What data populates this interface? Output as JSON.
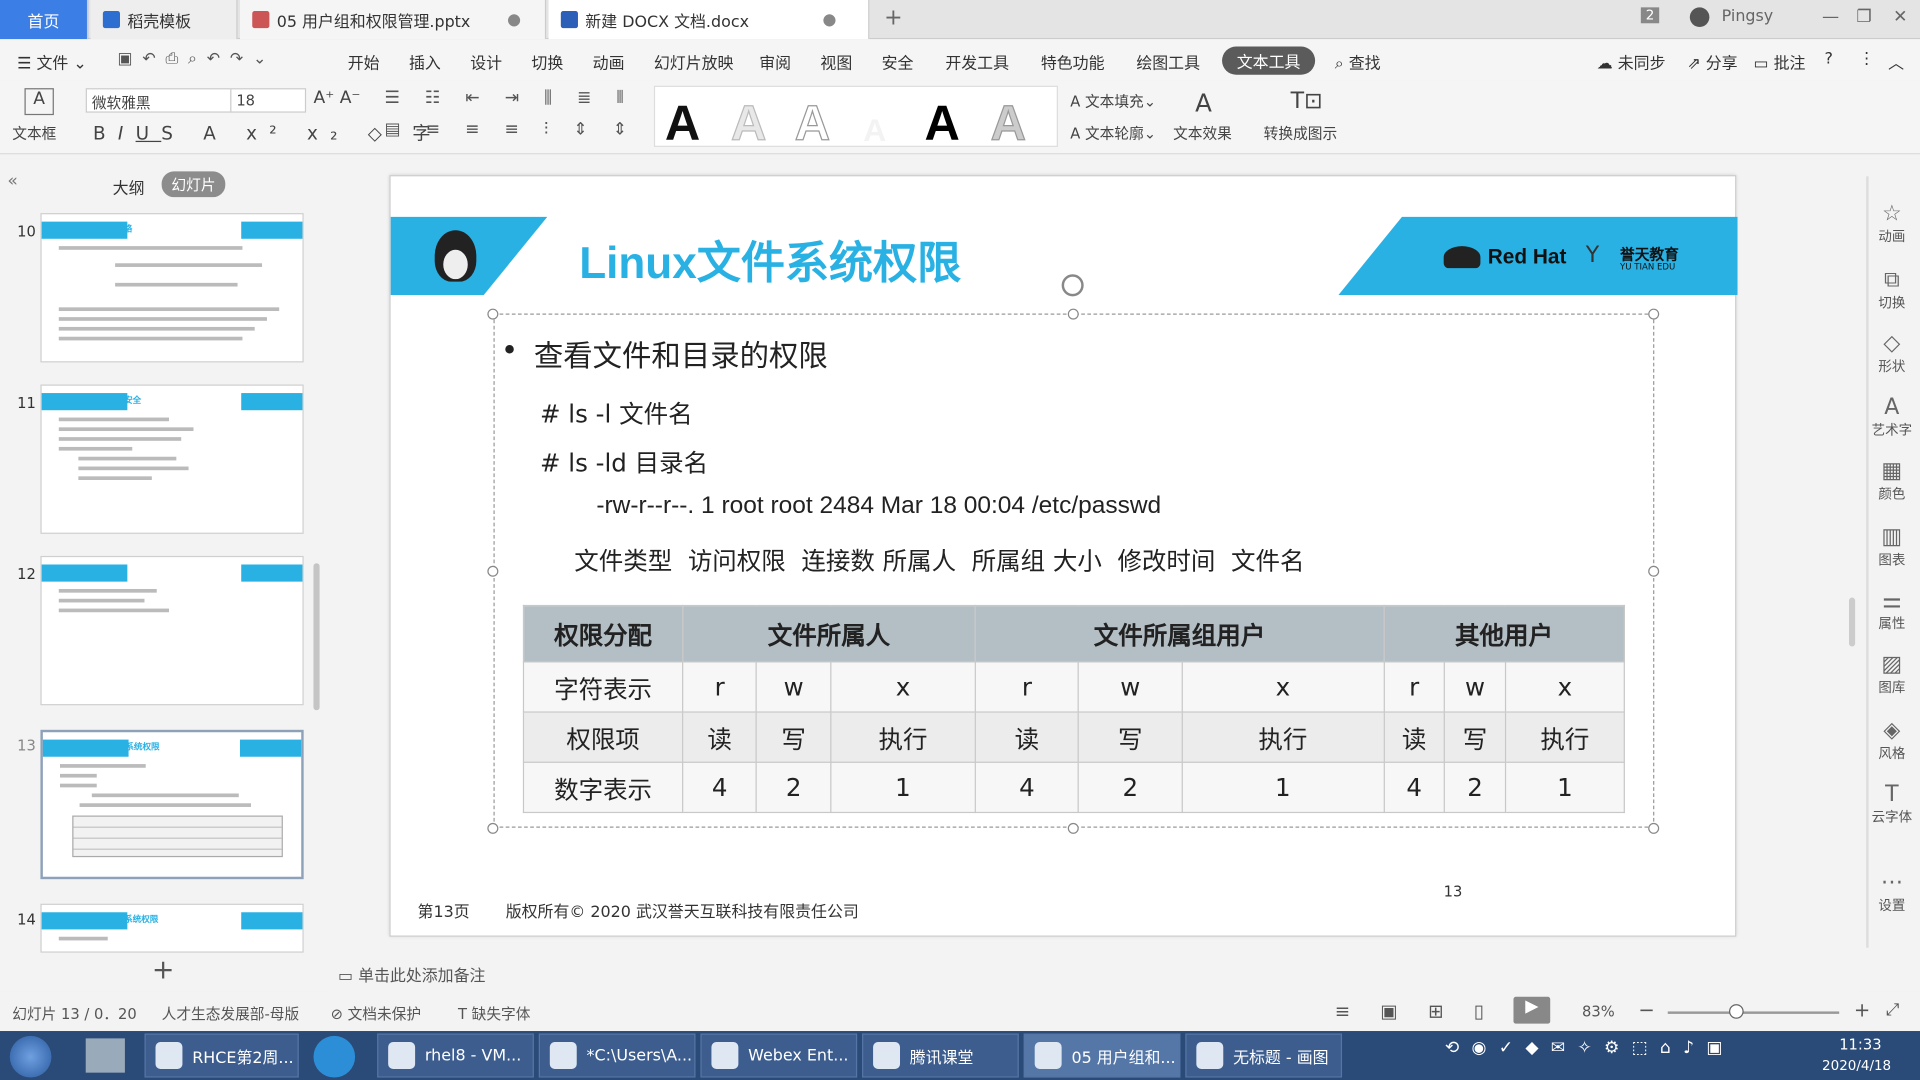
{
  "tabs": {
    "home": "首页",
    "template": "稻壳模板",
    "pptx": "05 用户组和权限管理.pptx",
    "docx": "新建 DOCX 文档.docx",
    "badge": "2",
    "user": "Pingsy"
  },
  "menu": {
    "file": "文件",
    "items": [
      "开始",
      "插入",
      "设计",
      "切换",
      "动画",
      "幻灯片放映",
      "审阅",
      "视图",
      "安全",
      "开发工具",
      "特色功能",
      "绘图工具",
      "文本工具"
    ],
    "search": "查找",
    "sync": "未同步",
    "share": "分享",
    "comment": "批注"
  },
  "ribbon": {
    "textbox": "文本框",
    "font": "微软雅黑",
    "size": "18",
    "fill": "文本填充",
    "outline": "文本轮廓",
    "effect": "文本效果",
    "convert": "转换成图示",
    "glyph": "A"
  },
  "panel": {
    "outline_tab": "大纲",
    "slides_tab": "幻灯片",
    "thumbs": [
      {
        "num": "10",
        "title": "配置密码策略"
      },
      {
        "num": "11",
        "title": "Linux文件安全"
      },
      {
        "num": "12",
        "title": "权限概念"
      },
      {
        "num": "13",
        "title": "Linux文件系统权限"
      },
      {
        "num": "14",
        "title": "Linux文件系统权限"
      }
    ],
    "add": "+"
  },
  "slide": {
    "title": "Linux文件系统权限",
    "brand": "Red Hat",
    "brand2": "誉天教育",
    "brand3": "YU TIAN EDU",
    "bullet": "查看文件和目录的权限",
    "cmd1": "# ls -l 文件名",
    "cmd2": "# ls -ld 目录名",
    "sample": "-rw-r--r--. 1 root root 2484 Mar 18 00:04 /etc/passwd",
    "legend": "文件类型  访问权限  连接数 所属人  所属组 大小  修改时间  文件名",
    "table": {
      "headers": [
        "权限分配",
        "文件所属人",
        "文件所属组用户",
        "其他用户"
      ],
      "rows": [
        [
          "字符表示",
          "r",
          "w",
          "x",
          "r",
          "w",
          "x",
          "r",
          "w",
          "x"
        ],
        [
          "权限项",
          "读",
          "写",
          "执行",
          "读",
          "写",
          "执行",
          "读",
          "写",
          "执行"
        ],
        [
          "数字表示",
          "4",
          "2",
          "1",
          "4",
          "2",
          "1",
          "4",
          "2",
          "1"
        ]
      ]
    },
    "footer_page": "第13页",
    "footer_copy": "版权所有© 2020 武汉誉天互联科技有限责任公司",
    "footer_num": "13"
  },
  "notes": "单击此处添加备注",
  "rightbar": [
    "动画",
    "切换",
    "形状",
    "艺术字",
    "颜色",
    "图表",
    "属性",
    "图库",
    "风格",
    "云字体",
    "设置"
  ],
  "status": {
    "slide": "幻灯片 13 / 0．20",
    "theme": "人才生态发展部-母版",
    "protect": "文档未保护",
    "font": "缺失字体",
    "zoom": "83%"
  },
  "taskbar": {
    "items": [
      "RHCE第2周...",
      "rhel8 - VM...",
      "*C:\\Users\\A...",
      "Webex Ent...",
      "腾讯课堂",
      "05 用户组和...",
      "无标题 - 画图"
    ],
    "time": "11:33",
    "date": "2020/4/18"
  }
}
